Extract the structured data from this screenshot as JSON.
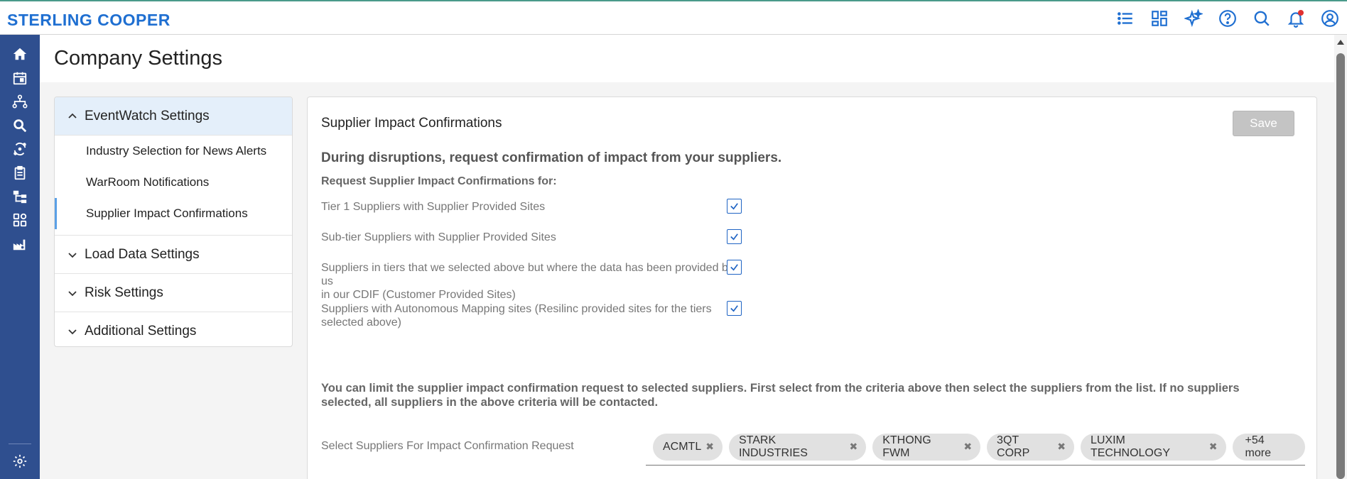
{
  "brand": "STERLING COOPER",
  "header_icons": [
    "list-icon",
    "dashboard-icon",
    "sparkle-ai-icon",
    "help-icon",
    "search-icon",
    "bell-icon",
    "user-profile-icon"
  ],
  "sidebar_icons": [
    "home-icon",
    "calendar-icon",
    "network-icon",
    "search-magnify-icon",
    "cycle-icon",
    "clipboard-icon",
    "hierarchy-icon",
    "apps-grid-icon",
    "factory-icon",
    "settings-gear-icon"
  ],
  "page_title": "Company Settings",
  "nav": {
    "groups": [
      {
        "label": "EventWatch Settings",
        "expanded": true,
        "items": [
          {
            "label": "Industry Selection for News Alerts"
          },
          {
            "label": "WarRoom Notifications"
          },
          {
            "label": "Supplier Impact Confirmations",
            "selected": true
          }
        ]
      },
      {
        "label": "Load Data Settings",
        "expanded": false
      },
      {
        "label": "Risk Settings",
        "expanded": false
      },
      {
        "label": "Additional Settings",
        "expanded": false
      }
    ]
  },
  "card": {
    "title": "Supplier Impact Confirmations",
    "save_label": "Save",
    "headline": "During disruptions, request confirmation of impact from your suppliers.",
    "sublabel": "Request Supplier Impact Confirmations for:",
    "options": [
      {
        "line1": "Tier 1 Suppliers with Supplier Provided Sites",
        "line2": "",
        "checked": true
      },
      {
        "line1": "Sub-tier Suppliers with Supplier Provided Sites",
        "line2": "",
        "checked": true
      },
      {
        "line1": "Suppliers in tiers that we selected above but where the data has been provided by us",
        "line2": "in our CDIF (Customer Provided Sites)",
        "checked": true
      },
      {
        "line1": "Suppliers with Autonomous Mapping sites (Resilinc provided sites for the tiers",
        "line2": "selected above)",
        "checked": true
      }
    ],
    "limit_note": "You can limit the supplier impact confirmation request to selected suppliers. First select from the criteria above then select the suppliers from the list. If no suppliers selected, all suppliers in the above criteria will be contacted.",
    "select_label": "Select Suppliers For Impact Confirmation Request",
    "chips": [
      {
        "label": "ACMTL"
      },
      {
        "label": "STARK INDUSTRIES"
      },
      {
        "label": "KTHONG FWM"
      },
      {
        "label": "3QT CORP"
      },
      {
        "label": "LUXIM TECHNOLOGY"
      }
    ],
    "more_label": "+54 more"
  },
  "colors": {
    "brand": "#1f6fd1",
    "sidebar": "#2f4f8f",
    "active_nav": "#e4effa",
    "checkbox": "#1f64c4"
  }
}
